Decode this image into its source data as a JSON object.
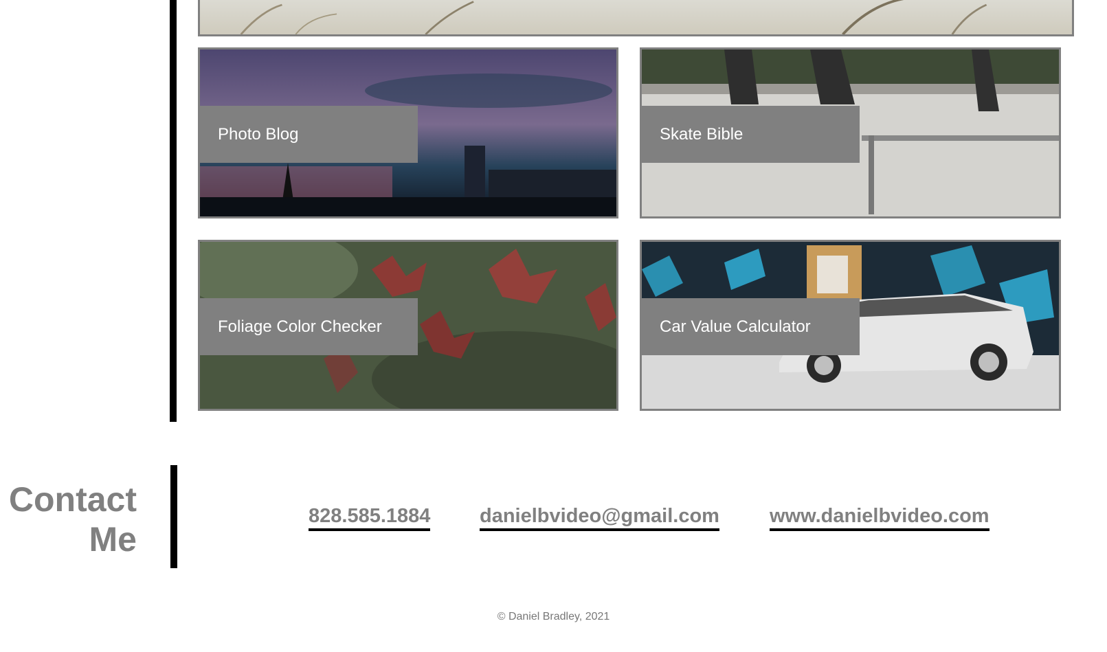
{
  "projects": [
    {
      "label": "Photo Blog",
      "icon": "city-skyline-image"
    },
    {
      "label": "Skate Bible",
      "icon": "skatepark-image"
    },
    {
      "label": "Foliage Color Checker",
      "icon": "maple-leaves-image"
    },
    {
      "label": "Car Value Calculator",
      "icon": "white-car-image"
    }
  ],
  "contact": {
    "title_line1": "Contact",
    "title_line2": "Me",
    "phone": "828.585.1884",
    "email": "danielbvideo@gmail.com",
    "website": "www.danielbvideo.com"
  },
  "footer": {
    "copyright": "© Daniel Bradley, 2021"
  },
  "colors": {
    "accent_gray": "#808080",
    "divider": "#000000"
  }
}
